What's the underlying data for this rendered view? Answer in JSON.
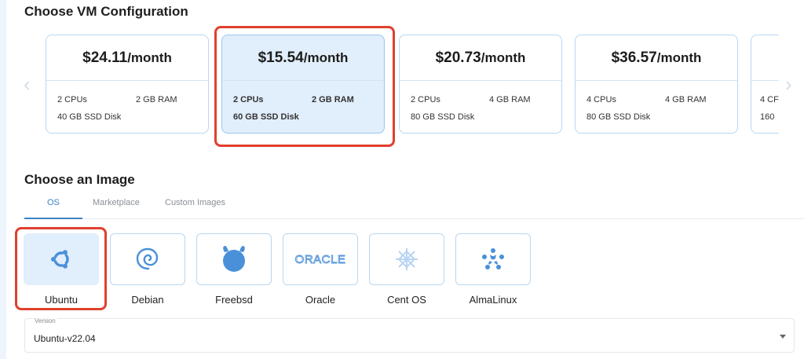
{
  "vm": {
    "heading": "Choose VM Configuration",
    "plans": [
      {
        "price": "$24.11",
        "period": "/month",
        "cpu": "2 CPUs",
        "ram": "2 GB RAM",
        "disk": "40 GB SSD Disk"
      },
      {
        "price": "$15.54",
        "period": "/month",
        "cpu": "2 CPUs",
        "ram": "2 GB RAM",
        "disk": "60 GB SSD Disk",
        "selected": true
      },
      {
        "price": "$20.73",
        "period": "/month",
        "cpu": "2 CPUs",
        "ram": "4 GB RAM",
        "disk": "80 GB SSD Disk"
      },
      {
        "price": "$36.57",
        "period": "/month",
        "cpu": "4 CPUs",
        "ram": "4 GB RAM",
        "disk": "80 GB SSD Disk"
      },
      {
        "price": "",
        "period": "",
        "cpu": "4 CF",
        "ram": "",
        "disk": "160"
      }
    ],
    "prev_icon": "chevron-left-icon",
    "next_icon": "chevron-right-icon"
  },
  "image": {
    "heading": "Choose an Image",
    "tabs": [
      {
        "label": "OS",
        "active": true
      },
      {
        "label": "Marketplace"
      },
      {
        "label": "Custom Images"
      }
    ],
    "os": [
      {
        "name": "Ubuntu",
        "icon": "ubuntu-icon",
        "selected": true
      },
      {
        "name": "Debian",
        "icon": "debian-icon"
      },
      {
        "name": "Freebsd",
        "icon": "freebsd-icon"
      },
      {
        "name": "Oracle",
        "icon": "oracle-icon",
        "logo_text": "ORACLE"
      },
      {
        "name": "Cent OS",
        "icon": "centos-icon"
      },
      {
        "name": "AlmaLinux",
        "icon": "almalinux-icon"
      }
    ],
    "version": {
      "label": "Version",
      "value": "Ubuntu-v22.04"
    }
  },
  "colors": {
    "accent": "#3b82c7",
    "highlight": "#e0402e",
    "selected_bg": "#e1eefb",
    "border": "#b9d6f0",
    "icon_blue": "#4a90d9"
  }
}
